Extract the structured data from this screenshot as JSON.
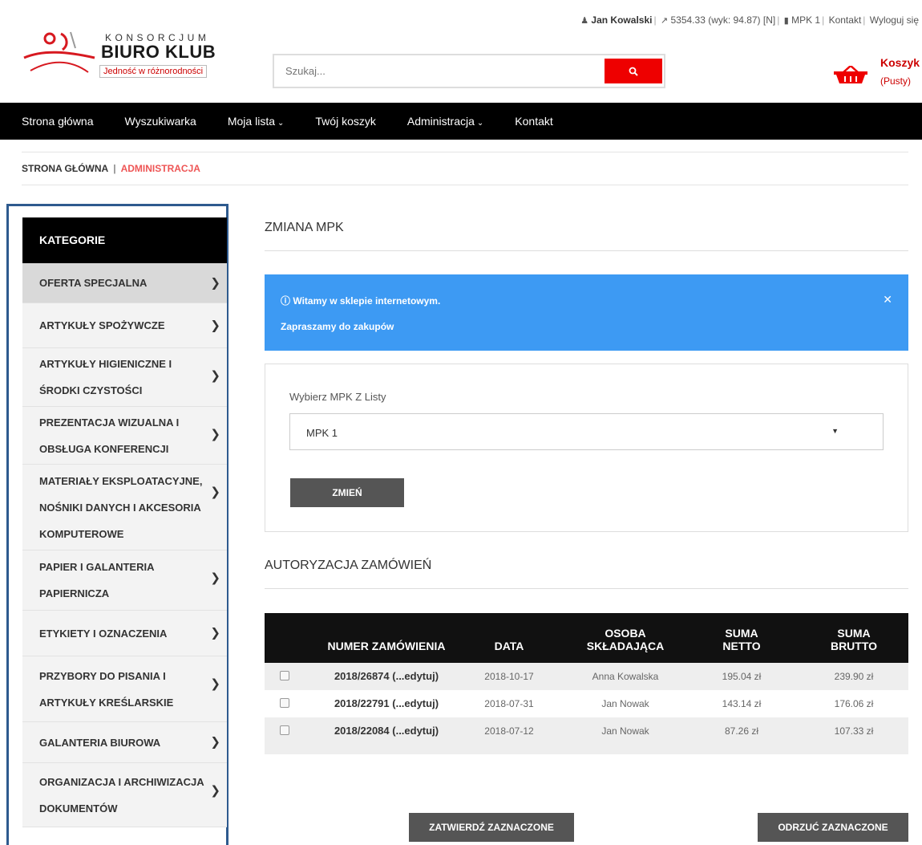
{
  "topbar": {
    "user": "Jan Kowalski",
    "budget": "5354.33 (wyk: 94.87) [N]",
    "mpk": "MPK 1",
    "contact": "Kontakt",
    "logout": "Wyloguj się",
    "sep": "|"
  },
  "logo": {
    "line1": "KONSORCJUM",
    "line2": "BIURO KLUB",
    "line3": "Jedność w różnorodności"
  },
  "search": {
    "placeholder": "Szukaj..."
  },
  "cart": {
    "title": "Koszyk",
    "status": "(Pusty)"
  },
  "nav": {
    "items": [
      {
        "label": "Strona główna"
      },
      {
        "label": "Wyszukiwarka"
      },
      {
        "label": "Moja lista",
        "dropdown": true
      },
      {
        "label": "Twój koszyk"
      },
      {
        "label": "Administracja",
        "dropdown": true
      },
      {
        "label": "Kontakt"
      }
    ]
  },
  "breadcrumb": {
    "home": "STRONA GŁÓWNA",
    "sep": "|",
    "current": "ADMINISTRACJA"
  },
  "sidebar": {
    "title": "KATEGORIE",
    "items": [
      {
        "label": "OFERTA SPECJALNA"
      },
      {
        "label": "ARTYKUŁY SPOŻYWCZE"
      },
      {
        "label": "ARTYKUŁY HIGIENICZNE I ŚRODKI CZYSTOŚCI"
      },
      {
        "label": "PREZENTACJA WIZUALNA I OBSŁUGA KONFERENCJI"
      },
      {
        "label": "MATERIAŁY EKSPLOATACYJNE, NOŚNIKI DANYCH I AKCESORIA KOMPUTEROWE"
      },
      {
        "label": "PAPIER I GALANTERIA PAPIERNICZA"
      },
      {
        "label": "ETYKIETY I OZNACZENIA"
      },
      {
        "label": "PRZYBORY DO PISANIA I ARTYKUŁY KREŚLARSKIE"
      },
      {
        "label": "GALANTERIA BIUROWA"
      },
      {
        "label": "ORGANIZACJA I ARCHIWIZACJA DOKUMENTÓW"
      }
    ]
  },
  "mpk_section": {
    "title": "ZMIANA MPK",
    "alert_line1": "Witamy w sklepie internetowym.",
    "alert_line2": "Zapraszamy do zakupów",
    "select_label": "Wybierz MPK Z Listy",
    "select_value": "MPK 1",
    "button": "ZMIEŃ"
  },
  "orders": {
    "title": "AUTORYZACJA ZAMÓWIEŃ",
    "headers": {
      "number": "NUMER ZAMÓWIENIA",
      "date": "DATA",
      "person_1": "OSOBA",
      "person_2": "SKŁADAJĄCA",
      "net_1": "SUMA",
      "net_2": "NETTO",
      "gross_1": "SUMA",
      "gross_2": "BRUTTO"
    },
    "rows": [
      {
        "number": "2018/26874 (...edytuj)",
        "date": "2018-10-17",
        "person": "Anna Kowalska",
        "net": "195.04 zł",
        "gross": "239.90 zł"
      },
      {
        "number": "2018/22791 (...edytuj)",
        "date": "2018-07-31",
        "person": "Jan Nowak",
        "net": "143.14 zł",
        "gross": "176.06 zł"
      },
      {
        "number": "2018/22084 (...edytuj)",
        "date": "2018-07-12",
        "person": "Jan Nowak",
        "net": "87.26 zł",
        "gross": "107.33 zł"
      }
    ],
    "approve_button": "ZATWIERDŹ ZAZNACZONE",
    "reject_button": "ODRZUĆ ZAZNACZONE"
  },
  "colors": {
    "accent_red": "#e00000",
    "alert_blue": "#3d9af3",
    "sidebar_border": "#2e5a8e"
  },
  "icons": [
    "user-icon",
    "chart-icon",
    "book-icon",
    "search-icon",
    "basket-icon",
    "chevron-right-icon",
    "info-icon",
    "close-icon",
    "chevron-down-icon"
  ]
}
